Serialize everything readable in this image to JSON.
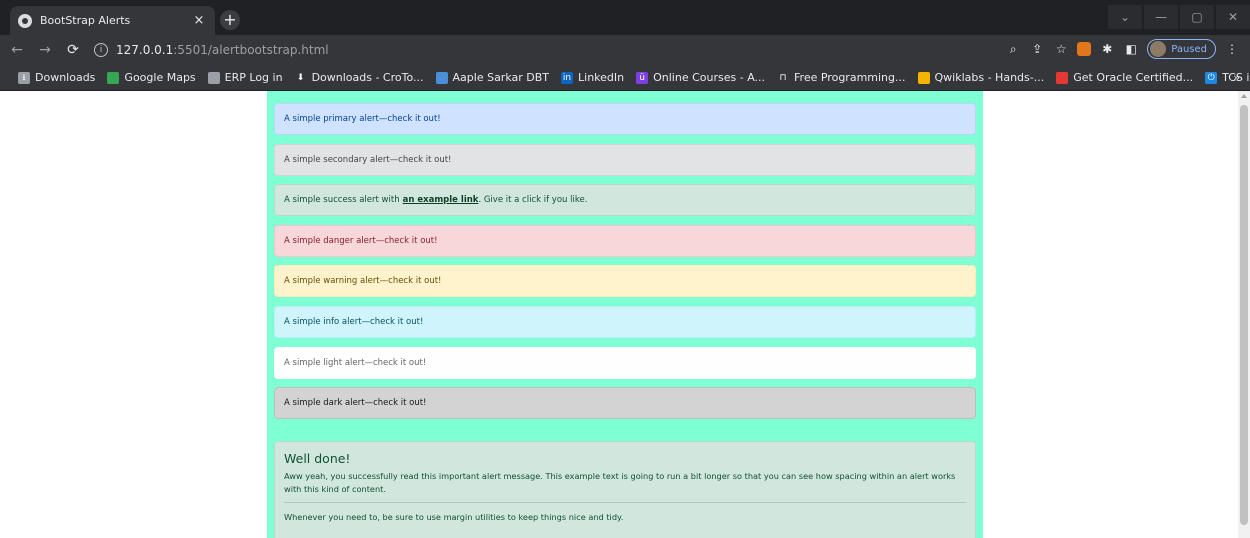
{
  "browser": {
    "tab_title": "BootStrap Alerts",
    "tab_close": "×",
    "new_tab": "+",
    "url_host": "127.0.0.1",
    "url_rest": ":5501/alertbootstrap.html",
    "profile_status": "Paused",
    "bookmarks": [
      {
        "label": "Downloads",
        "icon_color": "#9aa0a6",
        "glyph": "⭳"
      },
      {
        "label": "Google Maps",
        "icon_color": "#34a853",
        "glyph": ""
      },
      {
        "label": "ERP Log in",
        "icon_color": "#9aa0a6",
        "glyph": ""
      },
      {
        "label": "Downloads - CroTo...",
        "icon_color": "#35363a",
        "glyph": "⬇"
      },
      {
        "label": "Aaple Sarkar DBT",
        "icon_color": "#4a90d9",
        "glyph": ""
      },
      {
        "label": "LinkedIn",
        "icon_color": "#0a66c2",
        "glyph": "in"
      },
      {
        "label": "Online Courses - A...",
        "icon_color": "#7b3fe4",
        "glyph": "ü"
      },
      {
        "label": "Free Programming...",
        "icon_color": "#35363a",
        "glyph": "⊓"
      },
      {
        "label": "Qwiklabs - Hands-...",
        "icon_color": "#f4b400",
        "glyph": ""
      },
      {
        "label": "Get Oracle Certified...",
        "icon_color": "#e53935",
        "glyph": ""
      },
      {
        "label": "TCS iON Digital Lea...",
        "icon_color": "#1e88e5",
        "glyph": "⏻"
      }
    ],
    "bookmarks_more": "»"
  },
  "page": {
    "alerts": [
      {
        "variant": "primary",
        "text": "A simple primary alert—check it out!"
      },
      {
        "variant": "secondary",
        "text": "A simple secondary alert—check it out!"
      },
      {
        "variant": "danger",
        "text": "A simple danger alert—check it out!"
      },
      {
        "variant": "warning",
        "text": "A simple warning alert—check it out!"
      },
      {
        "variant": "info",
        "text": "A simple info alert—check it out!"
      },
      {
        "variant": "light",
        "text": "A simple light alert—check it out!"
      },
      {
        "variant": "dark",
        "text": "A simple dark alert—check it out!"
      }
    ],
    "success_alert": {
      "before": "A simple success alert with",
      "link": "an example link",
      "after": ". Give it a click if you like."
    },
    "big_alert": {
      "heading": "Well done!",
      "body": "Aww yeah, you successfully read this important alert message. This example text is going to run a bit longer so that you can see how spacing within an alert works with this kind of content.",
      "footer": "Whenever you need to, be sure to use margin utilities to keep things nice and tidy."
    },
    "container_color": "#7fffd4"
  }
}
